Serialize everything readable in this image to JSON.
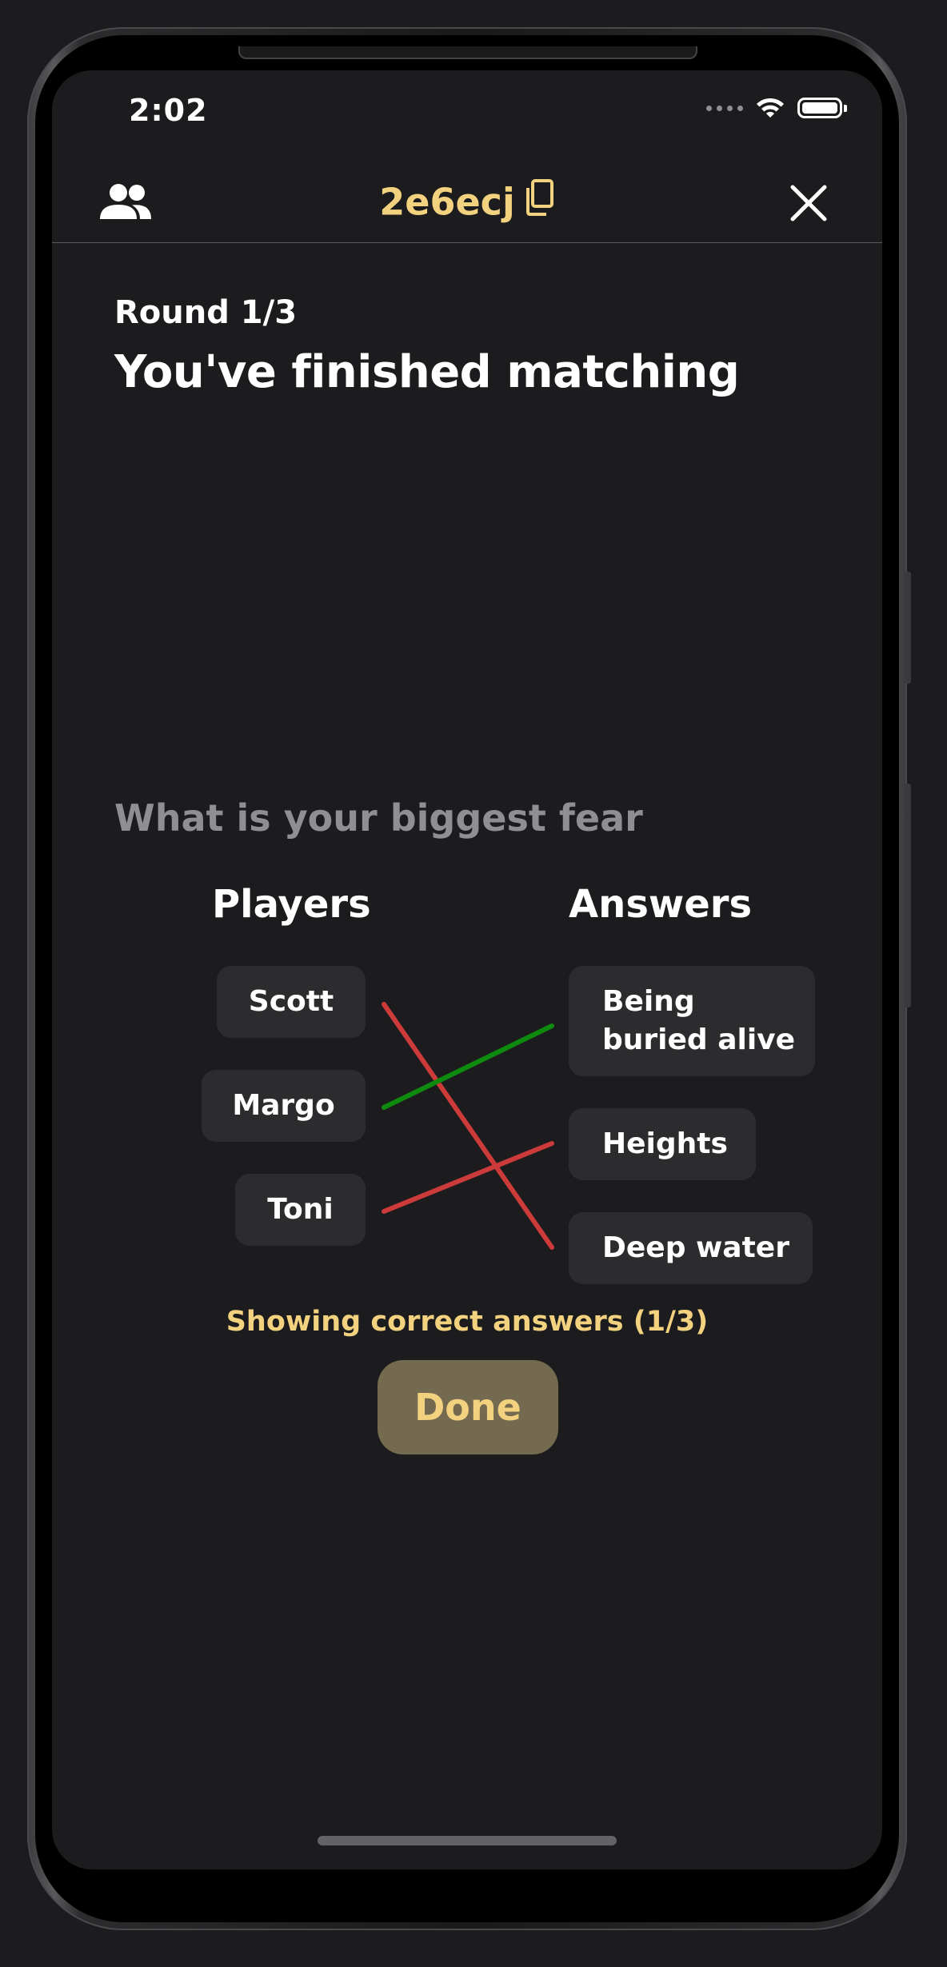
{
  "status_bar": {
    "time": "2:02"
  },
  "header": {
    "room_code": "2e6ecj",
    "players_icon": "people-icon",
    "copy_icon": "copy-icon",
    "close_icon": "close-icon"
  },
  "round": {
    "label": "Round 1/3",
    "title": "You've finished matching"
  },
  "question": "What is your biggest fear",
  "columns": {
    "players_title": "Players",
    "answers_title": "Answers"
  },
  "players": [
    "Scott",
    "Margo",
    "Toni"
  ],
  "answers": [
    "Being buried alive",
    "Heights",
    "Deep water"
  ],
  "matches": [
    {
      "player": "Scott",
      "answer": "Deep water",
      "correct": false
    },
    {
      "player": "Margo",
      "answer": "Being buried alive",
      "correct": true
    },
    {
      "player": "Toni",
      "answer": "Heights",
      "correct": false
    }
  ],
  "colors": {
    "correct": "#0e8a0e",
    "incorrect": "#cc3a3a",
    "accent": "#f3d27f"
  },
  "result_text": "Showing correct answers (1/3)",
  "done_label": "Done"
}
